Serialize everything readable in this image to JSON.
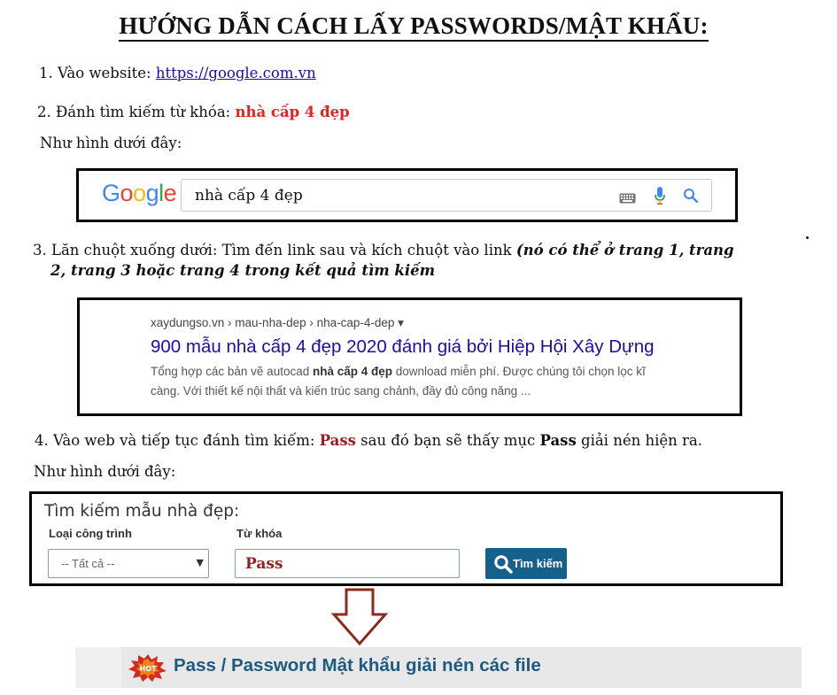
{
  "title": "HƯỚNG DẪN CÁCH LẤY PASSWORDS/MẬT KHẨU:",
  "steps": {
    "s1_prefix": "1. Vào website: ",
    "s1_link": "https://google.com.vn",
    "s2_prefix": "2. Đánh tìm kiếm từ khóa: ",
    "s2_keyword": "nhà cấp 4 đẹp",
    "as_below_1": "Như hình dưới đây:",
    "s3_prefix": "3. Lăn chuột xuống dưới: Tìm đến link sau và kích chuột vào link ",
    "s3_italic_1": "(nó có thể ở trang 1, trang",
    "s3_italic_2": "2, trang 3 hoặc trang 4 trong kết quả tìm kiếm",
    "s4_prefix": "4. Vào web và tiếp tục đánh tìm kiếm: ",
    "s4_keyword": "Pass",
    "s4_mid": " sau đó bạn sẽ thấy mục ",
    "s4_bold": "Pass",
    "s4_suffix": " giải nén hiện ra.",
    "as_below_2": "Như hình dưới đây:"
  },
  "google": {
    "logo": [
      "G",
      "o",
      "o",
      "g",
      "l",
      "e"
    ],
    "query": "nhà cấp 4 đẹp",
    "icons": [
      "keyboard-icon",
      "microphone-icon",
      "search-icon"
    ]
  },
  "result": {
    "url": "xaydungso.vn › mau-nha-dep › nha-cap-4-dep ▾",
    "title": "900 mẫu nhà cấp 4 đẹp 2020 đánh giá bởi Hiệp Hội Xây Dựng",
    "snippet_1_a": "Tổng hợp các bản vẽ autocad ",
    "snippet_1_b": "nhà cấp 4 đẹp",
    "snippet_1_c": " download miễn phí. Được chúng tôi chọn lọc kĩ",
    "snippet_2": "càng. Với thiết kế nội thất và kiến trúc sang chảnh, đầy đủ công năng ..."
  },
  "form": {
    "heading": "Tìm kiếm mẫu nhà đẹp:",
    "label_type": "Loại công trình",
    "label_keyword": "Từ khóa",
    "select_value": "-- Tất cả --",
    "input_value": "Pass",
    "button_label": "Tìm kiếm"
  },
  "banner": {
    "badge_icon": "hot-badge-icon",
    "text": "Pass / Password Mật khẩu giải nén các file"
  },
  "colors": {
    "link_blue": "#1a0dab",
    "keyword_red": "#e52222",
    "pass_maroon": "#9b1c1c",
    "button_blue": "#15618c",
    "banner_text": "#1d5a7d",
    "arrow_outline": "#8b2b1e"
  }
}
